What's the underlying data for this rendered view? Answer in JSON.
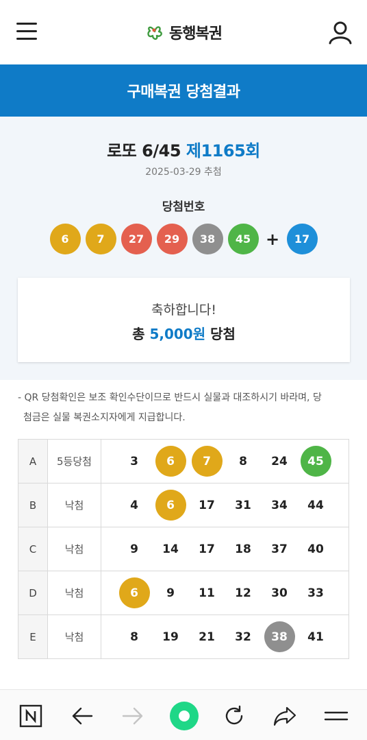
{
  "header": {
    "logo_text": "동행복권"
  },
  "titlebar": {
    "title": "구매복권 당첨결과"
  },
  "result": {
    "lottery_name": "로또 6/45",
    "round": "제1165회",
    "draw_date": "2025-03-29 추첨",
    "winning_label": "당첨번호",
    "winning_numbers": [
      "6",
      "7",
      "27",
      "29",
      "38",
      "45"
    ],
    "plus": "+",
    "bonus_number": "17",
    "congrats": "축하합니다!",
    "prize_prefix": "총",
    "prize_amount": "5,000원",
    "prize_suffix": "당첨"
  },
  "notice": {
    "line1": "- QR 당첨확인은 보조 확인수단이므로 반드시 실물과 대조하시기 바라며, 당",
    "line2": "첨금은 실물 복권소지자에게 지급합니다."
  },
  "games": [
    {
      "slot": "A",
      "rank": "5등당첨",
      "numbers": [
        "3",
        "6",
        "7",
        "8",
        "24",
        "45"
      ]
    },
    {
      "slot": "B",
      "rank": "낙첨",
      "numbers": [
        "4",
        "6",
        "17",
        "31",
        "34",
        "44"
      ]
    },
    {
      "slot": "C",
      "rank": "낙첨",
      "numbers": [
        "9",
        "14",
        "17",
        "18",
        "37",
        "40"
      ]
    },
    {
      "slot": "D",
      "rank": "낙첨",
      "numbers": [
        "6",
        "9",
        "11",
        "12",
        "30",
        "33"
      ]
    },
    {
      "slot": "E",
      "rank": "낙첨",
      "numbers": [
        "8",
        "19",
        "21",
        "32",
        "38",
        "41"
      ]
    }
  ],
  "colors": {
    "brand_blue": "#0f7bc7",
    "ball_yellow": "#e0a81a",
    "ball_blue": "#1e8fd9",
    "ball_red": "#e4604f",
    "ball_gray": "#8f8f8f",
    "ball_green": "#4fb547",
    "browser_green": "#1fd787"
  },
  "bottom_bar": {
    "icons": [
      "naver-n-icon",
      "back-arrow-icon",
      "forward-arrow-icon",
      "home-circle-icon",
      "refresh-icon",
      "share-icon",
      "menu-icon"
    ]
  }
}
